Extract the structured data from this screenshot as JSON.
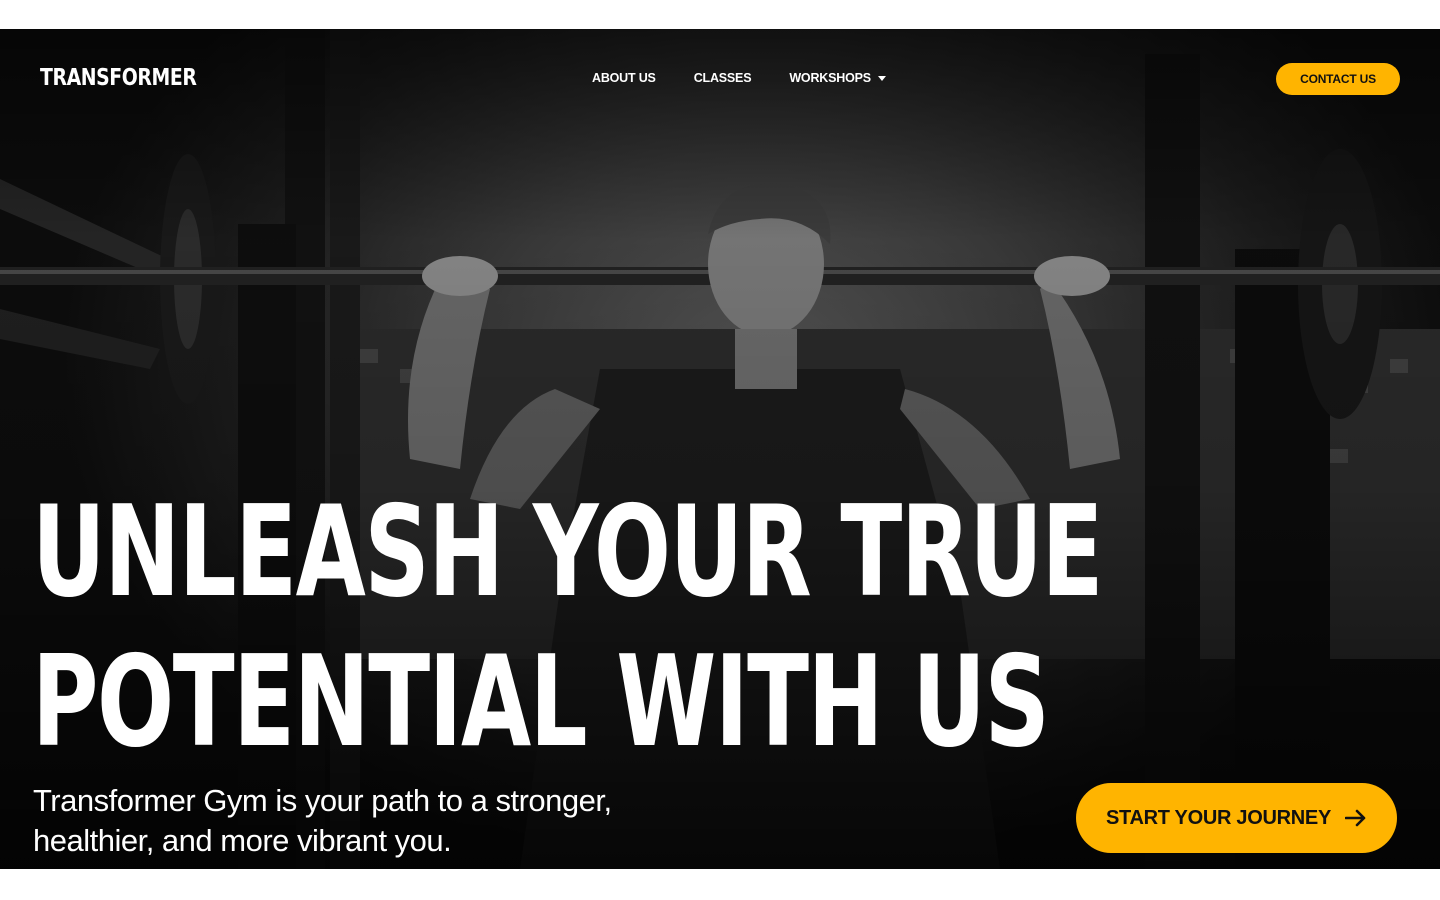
{
  "brand": {
    "logo_text": "TRANSFORMER"
  },
  "nav": {
    "items": [
      {
        "label": "ABOUT US"
      },
      {
        "label": "CLASSES"
      },
      {
        "label": "WORKSHOPS",
        "has_dropdown": true
      }
    ]
  },
  "header": {
    "contact_label": "CONTACT US"
  },
  "hero": {
    "headline_line1": "UNLEASH YOUR TRUE",
    "headline_line2": "POTENTIAL WITH US",
    "subtext": "Transformer Gym is your path to a stronger, healthier, and more vibrant you.",
    "cta_label": "START YOUR JOURNEY",
    "cta_icon": "arrow-right-icon",
    "background_image": "grayscale photo of man lifting barbell in gym"
  },
  "colors": {
    "accent": "#ffb400",
    "text": "#ffffff",
    "button_text": "#111111"
  }
}
